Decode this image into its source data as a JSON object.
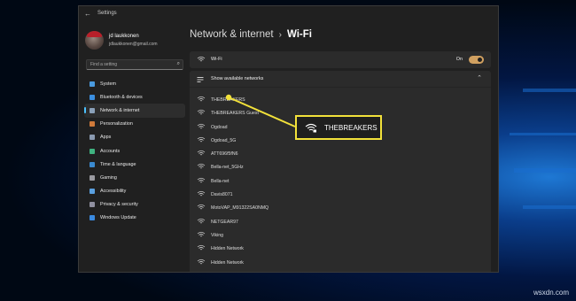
{
  "window": {
    "title": "Settings",
    "back_icon": "back-arrow-icon"
  },
  "user": {
    "name": "jd laukkonen",
    "email": "jdlaukkonen@gmail.com"
  },
  "search": {
    "placeholder": "Find a setting",
    "icon": "search-icon"
  },
  "nav": {
    "items": [
      {
        "label": "System",
        "icon": "system-icon",
        "color": "#4a9be0"
      },
      {
        "label": "Bluetooth & devices",
        "icon": "bluetooth-icon",
        "color": "#3b8fe0"
      },
      {
        "label": "Network & internet",
        "icon": "network-icon",
        "color": "#8aa0b8",
        "active": true
      },
      {
        "label": "Personalization",
        "icon": "personalization-icon",
        "color": "#d07a3a"
      },
      {
        "label": "Apps",
        "icon": "apps-icon",
        "color": "#8a9ab0"
      },
      {
        "label": "Accounts",
        "icon": "accounts-icon",
        "color": "#3fb27f"
      },
      {
        "label": "Time & language",
        "icon": "time-language-icon",
        "color": "#3a8ad0"
      },
      {
        "label": "Gaming",
        "icon": "gaming-icon",
        "color": "#9a9aa0"
      },
      {
        "label": "Accessibility",
        "icon": "accessibility-icon",
        "color": "#5aa0e0"
      },
      {
        "label": "Privacy & security",
        "icon": "privacy-icon",
        "color": "#9090a0"
      },
      {
        "label": "Windows Update",
        "icon": "windows-update-icon",
        "color": "#3a8ae0"
      }
    ]
  },
  "breadcrumb": {
    "parent": "Network & internet",
    "separator": "›",
    "current": "Wi-Fi"
  },
  "wifi": {
    "label": "Wi-Fi",
    "state": "On",
    "enabled": true,
    "accent": "#d0a060"
  },
  "networks": {
    "header": "Show available networks",
    "items": [
      "THEBREAKERS",
      "THEBREAKERS Guest",
      "Ogdoad",
      "Ogdoad_5G",
      "ATT696f5fN6",
      "Bella-net_5GHz",
      "Bella-net",
      "Davis8071",
      "MotoVAP_M91322SA0NMQ",
      "NETGEAR97",
      "Viking",
      "Hidden Network",
      "Hidden Network"
    ]
  },
  "callout": {
    "label": "THEBREAKERS",
    "border_color": "#f2e13a"
  },
  "watermark": "wsxdn.com"
}
